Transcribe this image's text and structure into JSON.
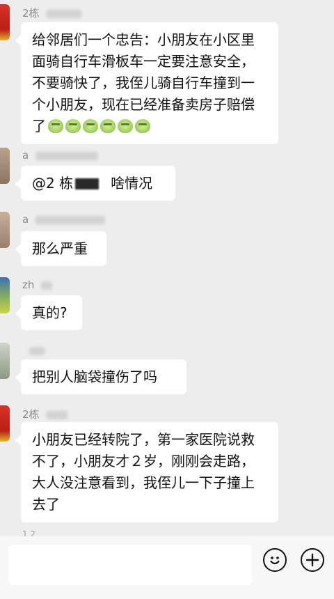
{
  "messages": [
    {
      "sender": "2栋",
      "text": "给邻居们一个忠告：小朋友在小区里面骑自行车滑板车一定要注意安全，不要骑快了，我侄儿骑自行车撞到一个小朋友，现在已经准备卖房子赔偿了",
      "emoji": [
        "crying-emoji",
        "crying-emoji",
        "crying-emoji",
        "crying-emoji",
        "crying-emoji",
        "crying-emoji"
      ]
    },
    {
      "sender": "a",
      "mention": "@2 栋",
      "text": "啥情况"
    },
    {
      "sender": "a",
      "text": "那么严重"
    },
    {
      "sender": "zh",
      "text": "真的?"
    },
    {
      "sender": "",
      "text": "把别人脑袋撞伤了吗"
    },
    {
      "sender": "2栋",
      "text": "小朋友已经转院了，第一家医院说救不了，小朋友才２岁，刚刚会走路，大人没注意看到，我侄儿一下子撞上去了"
    }
  ],
  "partial_sender": "1 2",
  "input_bar": {
    "placeholder": "",
    "emoji_button_icon": "smiley-icon",
    "plus_button_icon": "plus-icon"
  },
  "colors": {
    "background": "#ededed",
    "bubble": "#ffffff",
    "avatar_red": "#c8281e",
    "avatar_green": "#5f7d3a"
  }
}
